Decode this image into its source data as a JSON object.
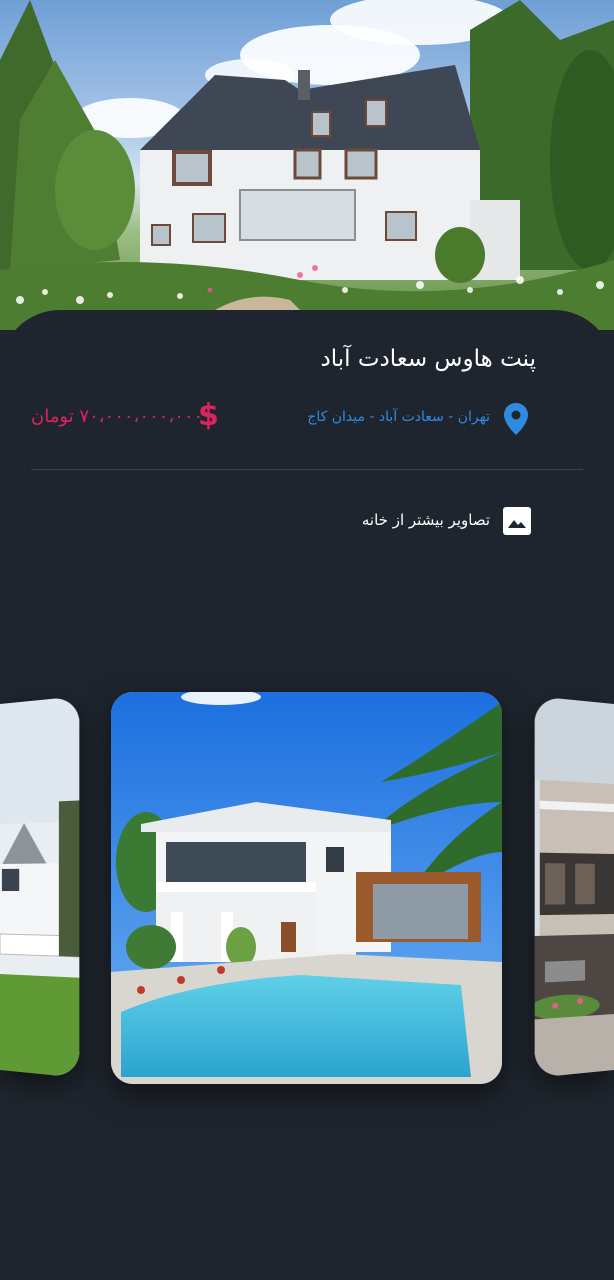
{
  "property": {
    "title": "پنت هاوس سعادت آباد",
    "location": "تهران - سعادت آباد - میدان کاج",
    "price": "۷۰،۰۰۰،۰۰۰،۰۰۰ تومان",
    "price_icon": "$"
  },
  "gallery": {
    "label": "تصاویر بیشتر از خانه",
    "icon": "image-icon",
    "cards": [
      "left-house-photo",
      "center-pool-house-photo",
      "right-modern-house-photo"
    ]
  },
  "colors": {
    "background": "#1f252e",
    "title": "#ffffff",
    "location": "#2f8ae0",
    "price": "#e0225e",
    "divider": "#3a414b"
  }
}
